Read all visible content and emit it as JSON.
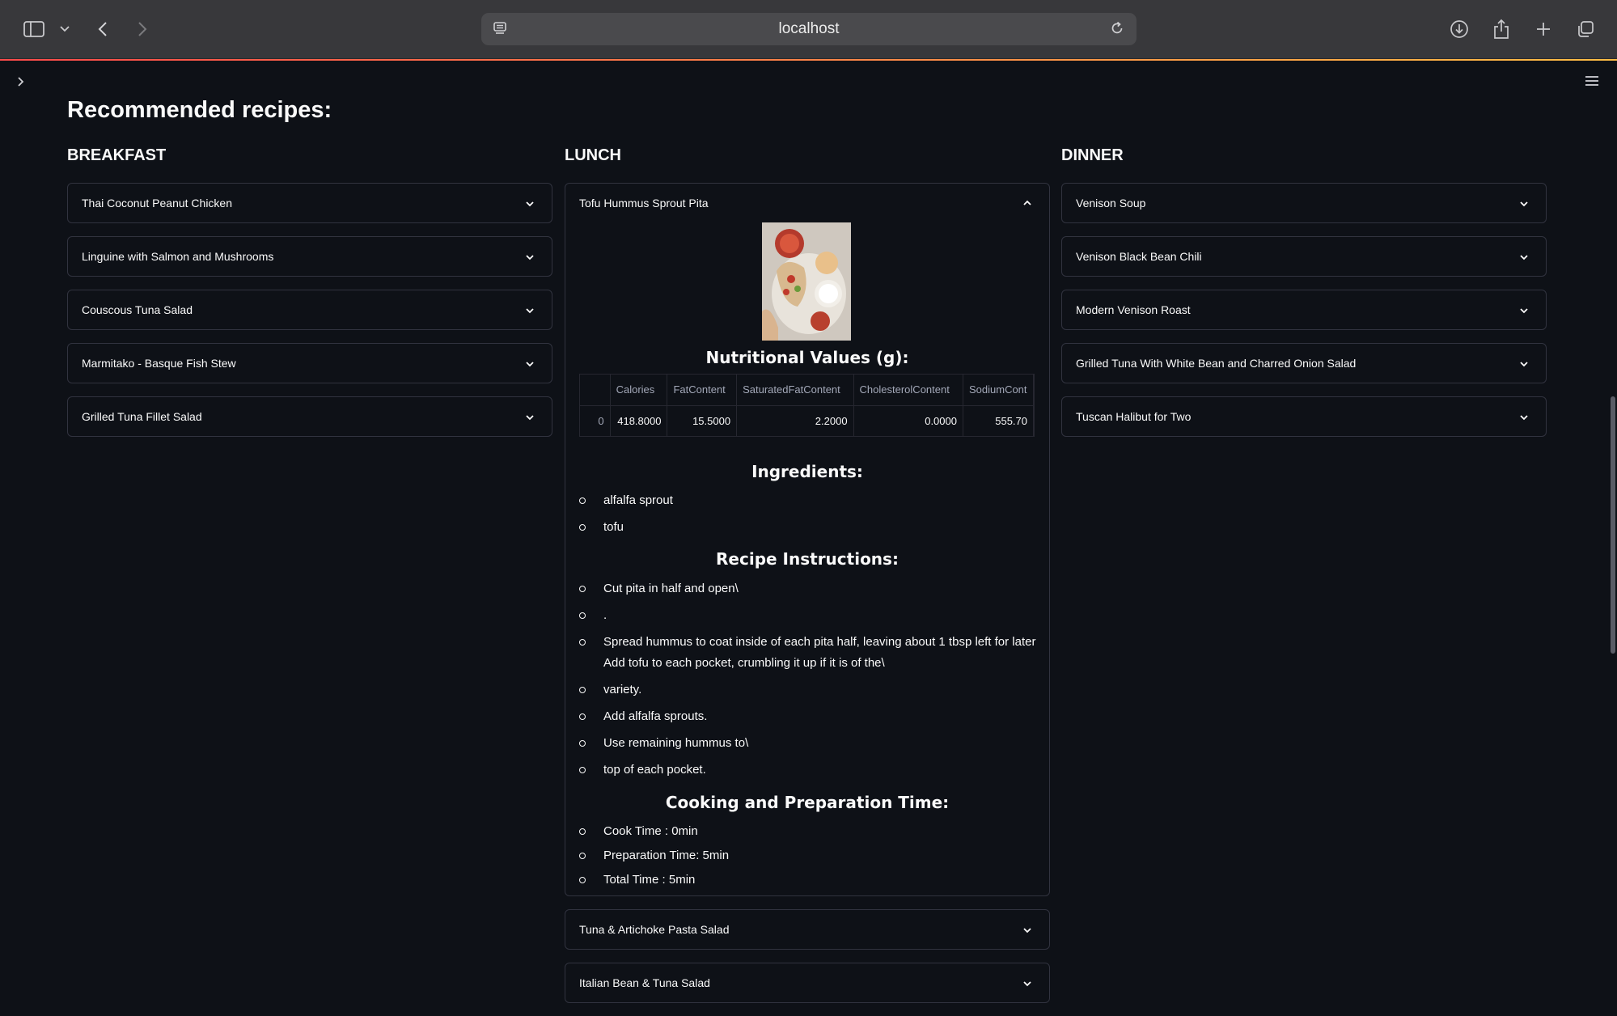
{
  "browser": {
    "url_host": "localhost"
  },
  "page": {
    "title": "Recommended recipes:"
  },
  "columns": {
    "breakfast": {
      "heading": "BREAKFAST",
      "items": [
        {
          "label": "Thai Coconut Peanut Chicken"
        },
        {
          "label": "Linguine with Salmon and Mushrooms"
        },
        {
          "label": "Couscous Tuna Salad"
        },
        {
          "label": "Marmitako - Basque Fish Stew"
        },
        {
          "label": "Grilled Tuna Fillet Salad"
        }
      ]
    },
    "lunch": {
      "heading": "LUNCH",
      "open_item": {
        "label": "Tofu Hummus Sprout Pita",
        "nutrition_heading": "Nutritional Values (g):",
        "table": {
          "columns": [
            "",
            "Calories",
            "FatContent",
            "SaturatedFatContent",
            "CholesterolContent",
            "SodiumCont"
          ],
          "rows": [
            [
              "0",
              "418.8000",
              "15.5000",
              "2.2000",
              "0.0000",
              "555.70"
            ]
          ]
        },
        "ingredients_heading": "Ingredients:",
        "ingredients": [
          "alfalfa sprout",
          "tofu"
        ],
        "instructions_heading": "Recipe Instructions:",
        "instructions": [
          "Cut pita in half and open\\",
          ".",
          "Spread hummus to coat inside of each pita half, leaving about 1 tbsp left for later Add tofu to each pocket, crumbling it up if it is of the\\",
          "variety.",
          "Add alfalfa sprouts.",
          "Use remaining hummus to\\",
          "top of each pocket."
        ],
        "time_heading": "Cooking and Preparation Time:",
        "times": [
          "Cook Time : 0min",
          "Preparation Time: 5min",
          "Total Time : 5min"
        ]
      },
      "items": [
        {
          "label": "Tuna & Artichoke Pasta Salad"
        },
        {
          "label": "Italian Bean & Tuna Salad"
        }
      ]
    },
    "dinner": {
      "heading": "DINNER",
      "items": [
        {
          "label": "Venison Soup"
        },
        {
          "label": "Venison Black Bean Chili"
        },
        {
          "label": "Modern Venison Roast"
        },
        {
          "label": "Grilled Tuna With White Bean and Charred Onion Salad"
        },
        {
          "label": "Tuscan Halibut for Two"
        }
      ]
    }
  },
  "colors": {
    "background": "#0e1117",
    "border": "#31333f",
    "text": "#fafafa"
  }
}
